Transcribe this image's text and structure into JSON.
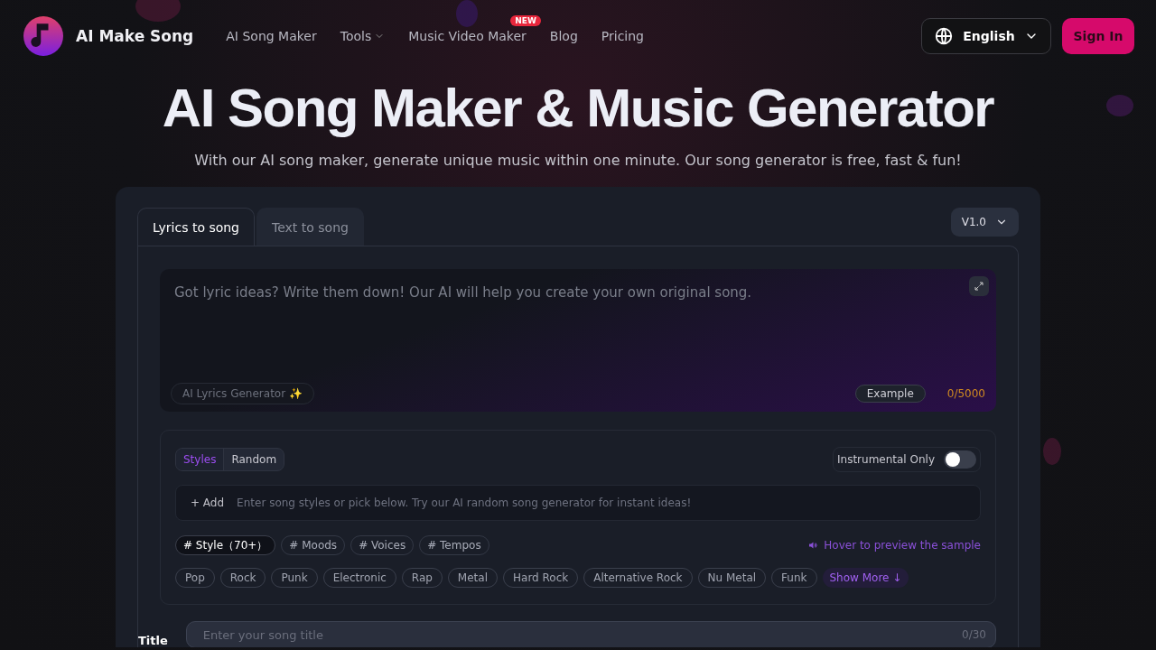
{
  "header": {
    "brand": "AI Make Song",
    "nav": [
      {
        "label": "AI Song Maker",
        "dropdown": false
      },
      {
        "label": "Tools",
        "dropdown": true
      },
      {
        "label": "Music Video Maker",
        "dropdown": false,
        "badge": "NEW"
      },
      {
        "label": "Blog",
        "dropdown": false
      },
      {
        "label": "Pricing",
        "dropdown": false
      }
    ],
    "language": "English",
    "sign_in": "Sign In"
  },
  "hero": {
    "title": "AI Song Maker & Music Generator",
    "subtitle": "With our AI song maker, generate unique music within one minute. Our song generator is free, fast & fun!"
  },
  "tabs": [
    {
      "label": "Lyrics to song",
      "selected": true
    },
    {
      "label": "Text to song",
      "selected": false
    }
  ],
  "version": "V1.0",
  "lyrics": {
    "placeholder": "Got lyric ideas? Write them down! Our AI will help you create your own original song.",
    "generator": "AI Lyrics Generator",
    "generator_emoji": "✨",
    "example": "Example",
    "count": "0/5000"
  },
  "style_modes": [
    {
      "label": "Styles",
      "selected": true
    },
    {
      "label": "Random",
      "selected": false
    }
  ],
  "instrumental": {
    "label": "Instrumental Only",
    "on": false
  },
  "style_input": {
    "add": "+ Add",
    "placeholder": "Enter song styles or pick below. Try our AI random song generator for instant ideas!"
  },
  "categories": [
    {
      "label": "# Style（70+）",
      "selected": true
    },
    {
      "label": "# Moods",
      "selected": false
    },
    {
      "label": "# Voices",
      "selected": false
    },
    {
      "label": "# Tempos",
      "selected": false
    }
  ],
  "hover_hint": "Hover to preview the sample",
  "styles": [
    "Pop",
    "Rock",
    "Punk",
    "Electronic",
    "Rap",
    "Metal",
    "Hard Rock",
    "Alternative Rock",
    "Nu Metal",
    "Funk"
  ],
  "show_more": "Show More ↓",
  "title_field": {
    "label": "Title",
    "placeholder": "Enter your song title",
    "count": "0/30"
  }
}
